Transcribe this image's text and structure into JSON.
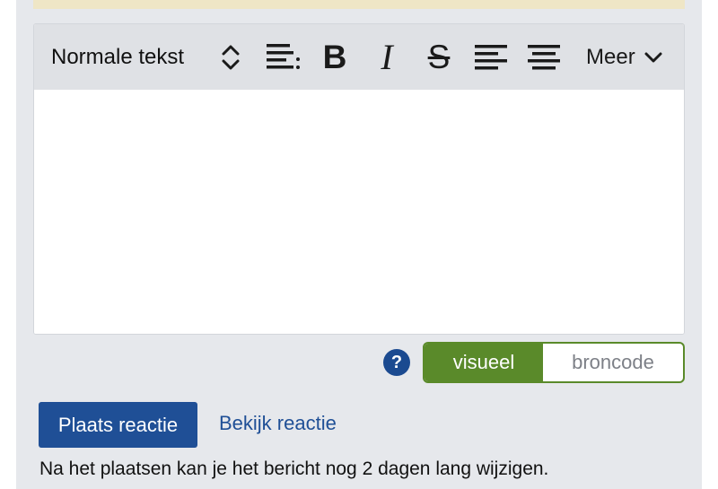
{
  "colors": {
    "panel_bg": "#e6e8ec",
    "toolbar_bg": "#dfe1e5",
    "notice_bg": "#efe6c6",
    "primary_blue": "#1f4f96",
    "toggle_green": "#5a8a2a"
  },
  "editor": {
    "toolbar": {
      "style_select": "Normale tekst",
      "style_select_icon": "chevron-up-down-icon",
      "list_icon": "list-indent-icon",
      "bold_label": "B",
      "italic_label": "I",
      "strike_label": "S",
      "align_left_icon": "align-left-icon",
      "align_center_icon": "align-center-icon",
      "more_label": "Meer",
      "more_icon": "chevron-down-icon"
    },
    "content": ""
  },
  "help": {
    "label": "?"
  },
  "mode_toggle": {
    "visual_label": "visueel",
    "source_label": "broncode",
    "selected": "visueel"
  },
  "actions": {
    "post_label": "Plaats reactie",
    "preview_label": "Bekijk reactie"
  },
  "hint": "Na het plaatsen kan je het bericht nog 2 dagen lang wijzigen."
}
